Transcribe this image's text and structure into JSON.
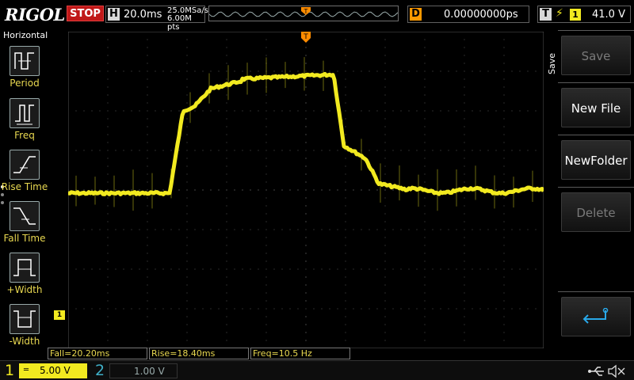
{
  "header": {
    "logo": "RIGOL",
    "run_state": "STOP",
    "timebase_tag": "H",
    "timebase": "20.0ms",
    "sample_rate": "25.0MSa/s",
    "memory_depth": "6.00M pts",
    "trigger_marker": "T",
    "delay_tag": "D",
    "delay": "0.00000000ps",
    "trigger_tag": "T",
    "trigger_channel": "1",
    "trigger_level": "41.0 V"
  },
  "left_menu": {
    "title": "Horizontal",
    "items": [
      {
        "label": "Period"
      },
      {
        "label": "Freq"
      },
      {
        "label": "Rise Time"
      },
      {
        "label": "Fall Time"
      },
      {
        "label": "+Width"
      },
      {
        "label": "-Width"
      }
    ]
  },
  "right_menu": {
    "title": "Save",
    "buttons": [
      {
        "label": "Save",
        "enabled": false
      },
      {
        "label": "New File",
        "enabled": true
      },
      {
        "label": "NewFolder",
        "enabled": true
      },
      {
        "label": "Delete",
        "enabled": false
      },
      {
        "label": "",
        "icon": "return-arrow-icon",
        "enabled": true
      }
    ]
  },
  "measurements": {
    "fall": "Fall=20.20ms",
    "rise": "Rise=18.40ms",
    "freq": "Freq=10.5 Hz"
  },
  "channels": [
    {
      "number": "1",
      "scale": "5.00 V",
      "active": true,
      "color": "#f2ea20"
    },
    {
      "number": "2",
      "scale": "1.00 V",
      "active": false,
      "color": "#3fb0c8"
    }
  ],
  "ch1_marker": "1",
  "trace_color": "#f2ea20",
  "colors": {
    "run_state": "#c01818",
    "accent": "#f2ea20",
    "trigger_marker": "#ff8c00"
  }
}
